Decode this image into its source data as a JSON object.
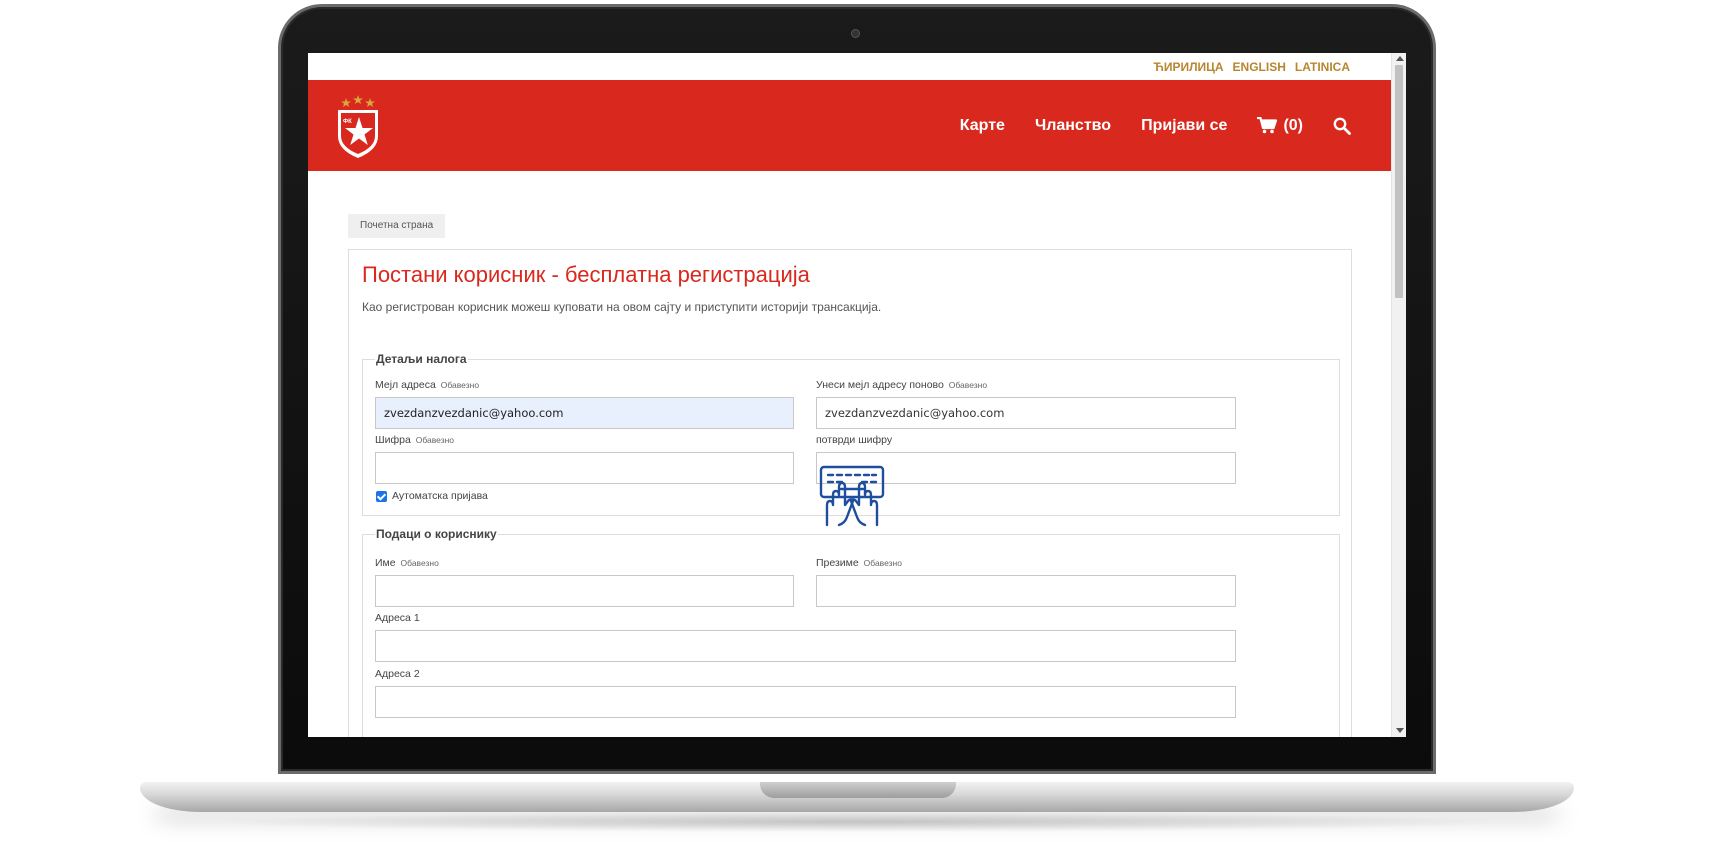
{
  "lang_bar": {
    "items": [
      "ЋИРИЛИЦА",
      "ENGLISH",
      "LATINICA"
    ]
  },
  "header": {
    "logo_icon": "red-star-crest-icon",
    "nav": {
      "tickets": "Карте",
      "membership": "Чланство",
      "login": "Пријави се",
      "cart": "(0)"
    },
    "cart_icon": "cart-icon",
    "search_icon": "search-icon",
    "brand_color": "#d9281d"
  },
  "breadcrumb": {
    "home": "Почетна страна"
  },
  "page": {
    "title": "Постани корисник - бесплатна регистрација",
    "subtitle": "Као регистрован корисник можеш куповати на овом сајту и приступити историји трансакција."
  },
  "account_details": {
    "legend": "Детаљи налога",
    "email_label": "Мејл адреса",
    "email_required": "Обавезно",
    "email_value": "zvezdanzvezdanic@yahoo.com",
    "email_confirm_label": "Унеси мејл адресу поново",
    "email_confirm_required": "Обавезно",
    "email_confirm_value": "zvezdanzvezdanic@yahoo.com",
    "password_label": "Шифра",
    "password_required": "Обавезно",
    "password_value": "",
    "password_confirm_label": "потврди шифру",
    "password_confirm_value": "",
    "auto_login_label": "Аутоматска пријава",
    "auto_login_checked": true
  },
  "user_details": {
    "legend": "Подаци о кориснику",
    "first_name_label": "Име",
    "first_name_required": "Обавезно",
    "last_name_label": "Презиме",
    "last_name_required": "Обавезно",
    "address1_label": "Адреса 1",
    "address2_label": "Адреса 2"
  },
  "overlay": {
    "icon": "typing-hands-keyboard-icon",
    "color": "#1f4f9c"
  }
}
